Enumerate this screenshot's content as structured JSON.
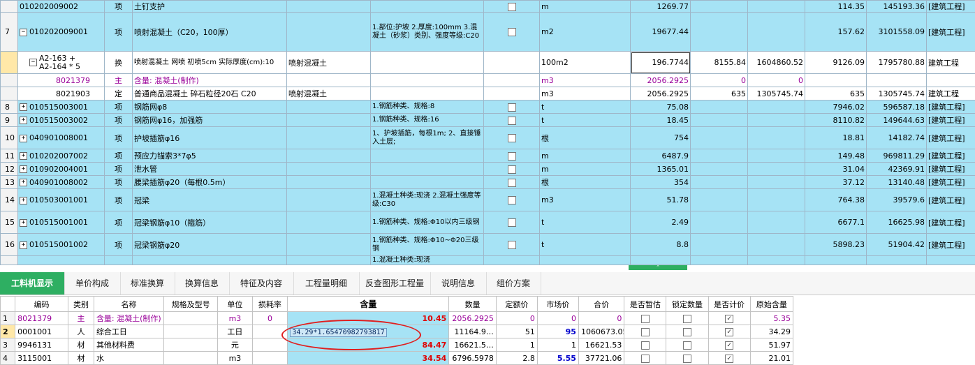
{
  "rows": [
    {
      "num": "",
      "expander": "",
      "code": "010202009002",
      "type": "项",
      "name": "土钉支护",
      "spec": "",
      "feature": "",
      "unit": "m",
      "qty": "1269.77",
      "c1": "",
      "c2": "",
      "c3": "114.35",
      "c4": "145193.36",
      "cat": "[建筑工程]"
    },
    {
      "num": "7",
      "expander": "−",
      "code": "010202009001",
      "type": "项",
      "name": "喷射混凝土（C20，100厚）",
      "spec": "",
      "feature": "1.部位:护坡\n2.厚度:100mm\n3.混凝土（砂浆）类别、强度等级:C20",
      "unit": "m2",
      "qty": "19677.44",
      "c1": "",
      "c2": "",
      "c3": "157.62",
      "c4": "3101558.09",
      "cat": "[建筑工程]"
    },
    {
      "num": "",
      "expander": "−",
      "code": "A2-163 +\nA2-164 * 5",
      "type": "换",
      "name": "喷射混凝土 网喷 初喷5cm  实际厚度(cm):10",
      "spec": "喷射混凝土",
      "feature": "",
      "unit": "100m2",
      "qty": "196.7744",
      "c1": "8155.84",
      "c2": "1604860.52",
      "c3": "9126.09",
      "c4": "1795780.88",
      "cat": "建筑工程"
    },
    {
      "num": "",
      "expander": "",
      "code": "8021379",
      "type": "主",
      "name": "含量: 混凝土(制作)",
      "spec": "",
      "feature": "",
      "unit": "m3",
      "qty": "2056.2925",
      "c1": "0",
      "c2": "0",
      "c3": "",
      "c4": "",
      "cat": ""
    },
    {
      "num": "",
      "expander": "",
      "code": "8021903",
      "type": "定",
      "name": "普通商品混凝土 碎石粒径20石 C20",
      "spec": "喷射混凝土",
      "feature": "",
      "unit": "m3",
      "qty": "2056.2925",
      "c1": "635",
      "c2": "1305745.74",
      "c3": "635",
      "c4": "1305745.74",
      "cat": "建筑工程"
    },
    {
      "num": "8",
      "expander": "+",
      "code": "010515003001",
      "type": "项",
      "name": "钢筋网φ8",
      "spec": "",
      "feature": "1.钢筋种类、规格:8",
      "unit": "t",
      "qty": "75.08",
      "c1": "",
      "c2": "",
      "c3": "7946.02",
      "c4": "596587.18",
      "cat": "[建筑工程]"
    },
    {
      "num": "9",
      "expander": "+",
      "code": "010515003002",
      "type": "项",
      "name": "钢筋网φ16，加强筋",
      "spec": "",
      "feature": "1.钢筋种类、规格:16",
      "unit": "t",
      "qty": "18.45",
      "c1": "",
      "c2": "",
      "c3": "8110.82",
      "c4": "149644.63",
      "cat": "[建筑工程]"
    },
    {
      "num": "10",
      "expander": "+",
      "code": "040901008001",
      "type": "项",
      "name": "护坡插筋φ16",
      "spec": "",
      "feature": "1、护坡插筋，每根1m;\n2、直接锤入土层;",
      "unit": "根",
      "qty": "754",
      "c1": "",
      "c2": "",
      "c3": "18.81",
      "c4": "14182.74",
      "cat": "[建筑工程]"
    },
    {
      "num": "11",
      "expander": "+",
      "code": "010202007002",
      "type": "项",
      "name": "预应力锚索3*7φ5",
      "spec": "",
      "feature": "",
      "unit": "m",
      "qty": "6487.9",
      "c1": "",
      "c2": "",
      "c3": "149.48",
      "c4": "969811.29",
      "cat": "[建筑工程]"
    },
    {
      "num": "12",
      "expander": "+",
      "code": "010902004001",
      "type": "项",
      "name": "泄水管",
      "spec": "",
      "feature": "",
      "unit": "m",
      "qty": "1365.01",
      "c1": "",
      "c2": "",
      "c3": "31.04",
      "c4": "42369.91",
      "cat": "[建筑工程]"
    },
    {
      "num": "13",
      "expander": "+",
      "code": "040901008002",
      "type": "项",
      "name": "腰梁插筋φ20（每根0.5m）",
      "spec": "",
      "feature": "",
      "unit": "根",
      "qty": "354",
      "c1": "",
      "c2": "",
      "c3": "37.12",
      "c4": "13140.48",
      "cat": "[建筑工程]"
    },
    {
      "num": "14",
      "expander": "+",
      "code": "010503001001",
      "type": "项",
      "name": "冠梁",
      "spec": "",
      "feature": "1.混凝土种类:现浇\n2.混凝土强度等级:C30",
      "unit": "m3",
      "qty": "51.78",
      "c1": "",
      "c2": "",
      "c3": "764.38",
      "c4": "39579.6",
      "cat": "[建筑工程]"
    },
    {
      "num": "15",
      "expander": "+",
      "code": "010515001001",
      "type": "项",
      "name": "冠梁钢筋φ10（箍筋）",
      "spec": "",
      "feature": "1.钢筋种类、规格:Φ10以内三级钢",
      "unit": "t",
      "qty": "2.49",
      "c1": "",
      "c2": "",
      "c3": "6677.1",
      "c4": "16625.98",
      "cat": "[建筑工程]"
    },
    {
      "num": "16",
      "expander": "+",
      "code": "010515001002",
      "type": "项",
      "name": "冠梁钢筋φ20",
      "spec": "",
      "feature": "1.钢筋种类、规格:Φ10~Φ20三级钢",
      "unit": "t",
      "qty": "8.8",
      "c1": "",
      "c2": "",
      "c3": "5898.23",
      "c4": "51904.42",
      "cat": "[建筑工程]"
    },
    {
      "num": "",
      "expander": "",
      "code": "",
      "type": "",
      "name": "",
      "spec": "",
      "feature": "1.混凝土种类:现浇",
      "unit": "",
      "qty": "",
      "c1": "",
      "c2": "",
      "c3": "",
      "c4": "",
      "cat": ""
    }
  ],
  "tabs": [
    "工料机显示",
    "单价构成",
    "标准换算",
    "换算信息",
    "特征及内容",
    "工程量明细",
    "反查图形工程量",
    "说明信息",
    "组价方案"
  ],
  "sub_headers": [
    "",
    "编码",
    "类别",
    "名称",
    "规格及型号",
    "单位",
    "损耗率",
    "含量",
    "数量",
    "定额价",
    "市场价",
    "合价",
    "是否暂估",
    "锁定数量",
    "是否计价",
    "原始含量"
  ],
  "sub_rows": [
    {
      "n": "1",
      "code": "8021379",
      "type": "主",
      "name": "含量: 混凝土(制作)",
      "spec": "",
      "unit": "m3",
      "loss": "0",
      "content": "10.45",
      "qty": "2056.2925",
      "dj": "0",
      "sj": "0",
      "hj": "0",
      "est": false,
      "lock": false,
      "price": true,
      "orig": "5.35"
    },
    {
      "n": "2",
      "code": "0001001",
      "type": "人",
      "name": "综合工日",
      "spec": "",
      "unit": "工日",
      "loss": "",
      "content": "34.29*1.65470982793817",
      "qty": "11164.9…",
      "dj": "51",
      "sj": "95",
      "hj": "1060673.05",
      "est": false,
      "lock": false,
      "price": true,
      "orig": "34.29"
    },
    {
      "n": "3",
      "code": "9946131",
      "type": "材",
      "name": "其他材料费",
      "spec": "",
      "unit": "元",
      "loss": "",
      "content": "84.47",
      "qty": "16621.5…",
      "dj": "1",
      "sj": "1",
      "hj": "16621.53",
      "est": false,
      "lock": false,
      "price": true,
      "orig": "51.97"
    },
    {
      "n": "4",
      "code": "3115001",
      "type": "材",
      "name": "水",
      "spec": "",
      "unit": "m3",
      "loss": "",
      "content": "34.54",
      "qty": "6796.5978",
      "dj": "2.8",
      "sj": "5.55",
      "hj": "37721.06",
      "est": false,
      "lock": false,
      "price": true,
      "orig": "21.01"
    }
  ],
  "colors": {
    "row_blue": "#a6e3f5",
    "tab_active": "#2eaf62",
    "ellipse": "#e02020",
    "selected_row": "#ffe8a8"
  }
}
